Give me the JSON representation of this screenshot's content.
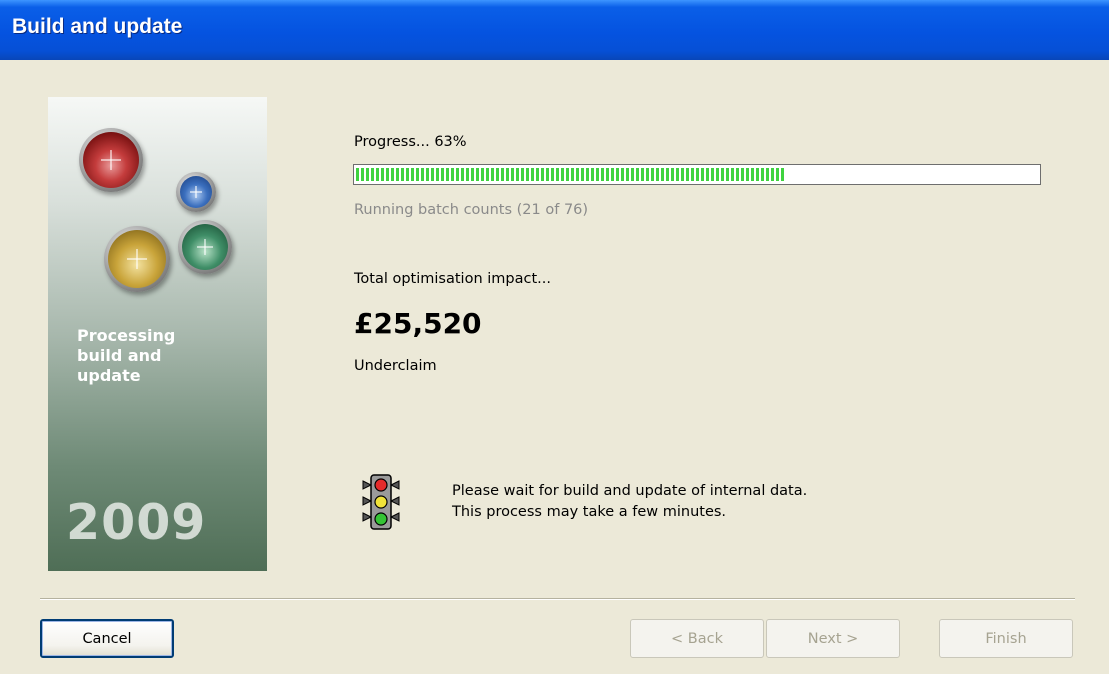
{
  "window": {
    "title": "Build and update"
  },
  "banner": {
    "text": "Processing\nbuild and\nupdate",
    "year": "2009"
  },
  "progress": {
    "label": "Progress... 63%",
    "fraction": 0.63,
    "status": "Running batch counts (21 of 76)"
  },
  "impact": {
    "label": "Total optimisation impact...",
    "value": "£25,520",
    "type": "Underclaim"
  },
  "message": {
    "line1": "Please wait for build and update of internal data.",
    "line2": "This process may take a few minutes."
  },
  "buttons": {
    "cancel": "Cancel",
    "back": "< Back",
    "next": "Next >",
    "finish": "Finish"
  },
  "colors": {
    "title_bar": "#0553e0",
    "progress_fill": "#3fd33f",
    "face": "#ece9d8"
  },
  "icons": {
    "traffic": "traffic-light-icon"
  }
}
